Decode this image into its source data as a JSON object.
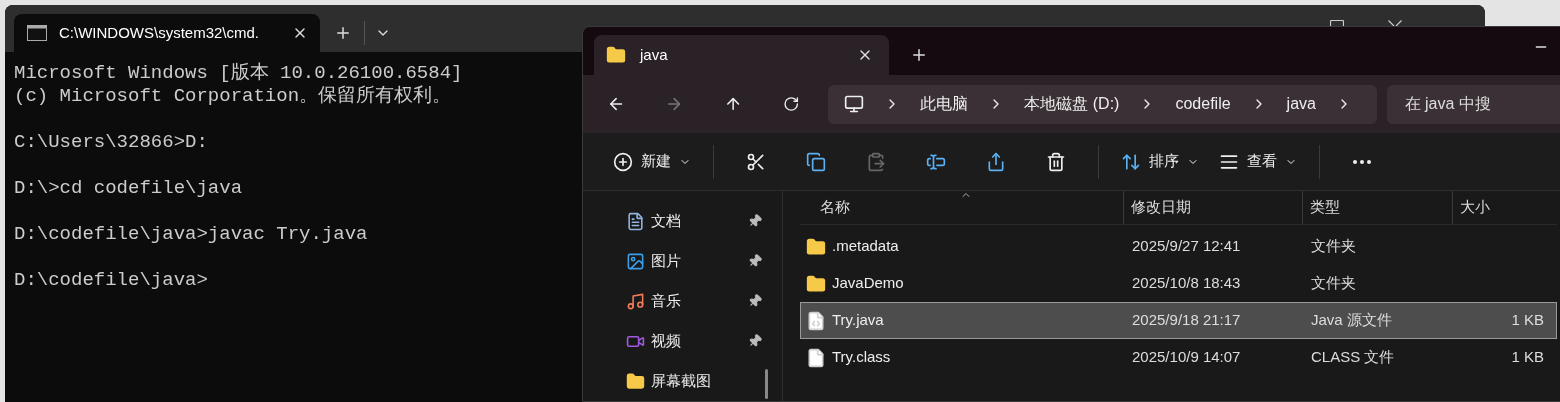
{
  "terminal": {
    "tabs": [
      {
        "title": "C:\\WINDOWS\\system32\\cmd.",
        "selected": true
      }
    ],
    "paragraphs": [
      [
        "Microsoft Windows [版本 10.0.26100.6584]",
        "(c) Microsoft Corporation。保留所有权利。"
      ],
      [
        "C:\\Users\\32866>D:"
      ],
      [
        "D:\\>cd codefile\\java"
      ],
      [
        "D:\\codefile\\java>javac Try.java"
      ],
      [
        "D:\\codefile\\java>"
      ]
    ]
  },
  "explorer": {
    "tabs": [
      {
        "title": "java",
        "selected": true
      }
    ],
    "breadcrumb": [
      "此电脑",
      "本地磁盘 (D:)",
      "codefile",
      "java"
    ],
    "search": {
      "placeholder": "在 java 中搜"
    },
    "toolbar": [
      {
        "kind": "new",
        "label": "新建",
        "disabled": false
      },
      {
        "kind": "cut",
        "disabled": false
      },
      {
        "kind": "copy",
        "disabled": false
      },
      {
        "kind": "paste",
        "disabled": true
      },
      {
        "kind": "rename",
        "disabled": false
      },
      {
        "kind": "share",
        "disabled": false
      },
      {
        "kind": "delete",
        "disabled": false
      },
      {
        "kind": "sort",
        "label": "排序",
        "disabled": false
      },
      {
        "kind": "view",
        "label": "查看",
        "disabled": false
      },
      {
        "kind": "more",
        "disabled": false
      }
    ],
    "sidebar": {
      "items": [
        {
          "label": "文档",
          "kind": "documents",
          "pinned": true
        },
        {
          "label": "图片",
          "kind": "pictures",
          "pinned": true
        },
        {
          "label": "音乐",
          "kind": "music",
          "pinned": true
        },
        {
          "label": "视频",
          "kind": "videos",
          "pinned": true
        },
        {
          "label": "屏幕截图",
          "kind": "folder",
          "pinned": false
        }
      ]
    },
    "table": {
      "columns": [
        "名称",
        "修改日期",
        "类型",
        "大小"
      ],
      "rows": [
        {
          "kind": "folder",
          "name": ".metadata",
          "date": "2025/9/27 12:41",
          "type": "文件夹",
          "selected": false
        },
        {
          "kind": "folder",
          "name": "JavaDemo",
          "date": "2025/10/8 18:43",
          "type": "文件夹",
          "selected": false
        },
        {
          "kind": "java",
          "name": "Try.java",
          "date": "2025/9/18 21:17",
          "type": "Java 源文件",
          "size": "1 KB",
          "selected": true
        },
        {
          "kind": "file",
          "name": "Try.class",
          "date": "2025/10/9 14:07",
          "type": "CLASS 文件",
          "size": "1 KB",
          "selected": false
        }
      ]
    }
  }
}
